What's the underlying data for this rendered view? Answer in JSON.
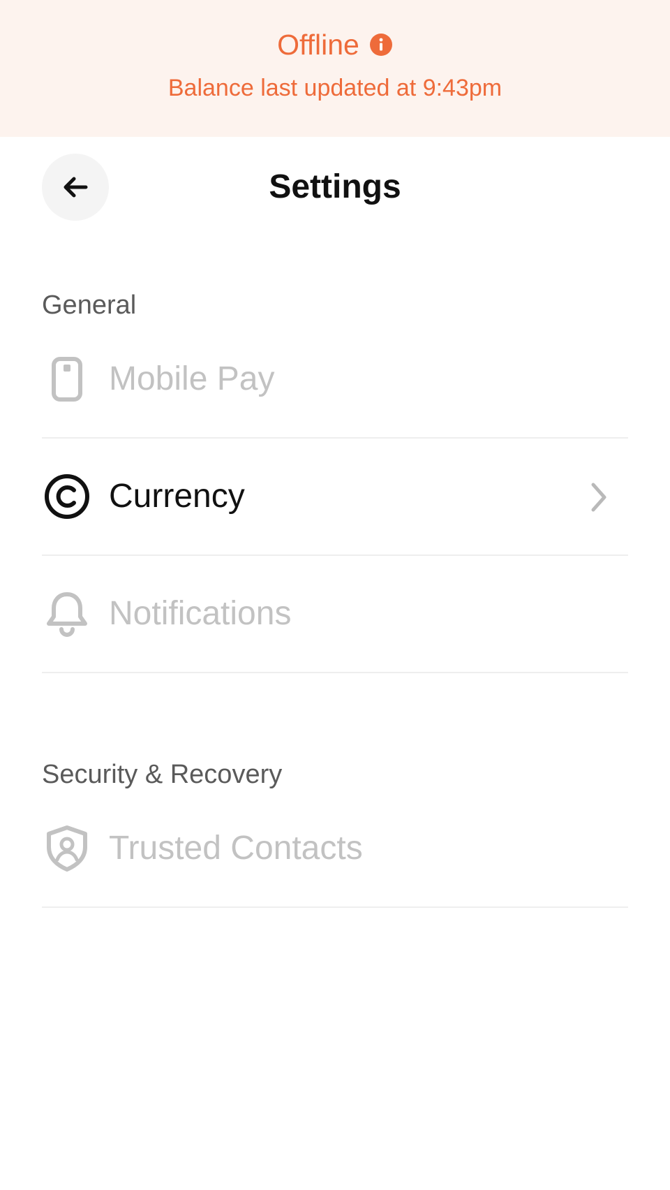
{
  "banner": {
    "title": "Offline",
    "subtitle": "Balance last updated at 9:43pm",
    "icon": "info-icon",
    "color": "#ee6b3a",
    "background": "#fdf3ee"
  },
  "header": {
    "title": "Settings",
    "back_icon": "arrow-left-icon"
  },
  "sections": [
    {
      "label": "General",
      "items": [
        {
          "label": "Mobile Pay",
          "icon": "phone-icon",
          "enabled": false
        },
        {
          "label": "Currency",
          "icon": "copyright-icon",
          "enabled": true,
          "chevron": "chevron-right-icon"
        },
        {
          "label": "Notifications",
          "icon": "bell-icon",
          "enabled": false
        }
      ]
    },
    {
      "label": "Security & Recovery",
      "items": [
        {
          "label": "Trusted Contacts",
          "icon": "shield-user-icon",
          "enabled": false
        }
      ]
    }
  ]
}
